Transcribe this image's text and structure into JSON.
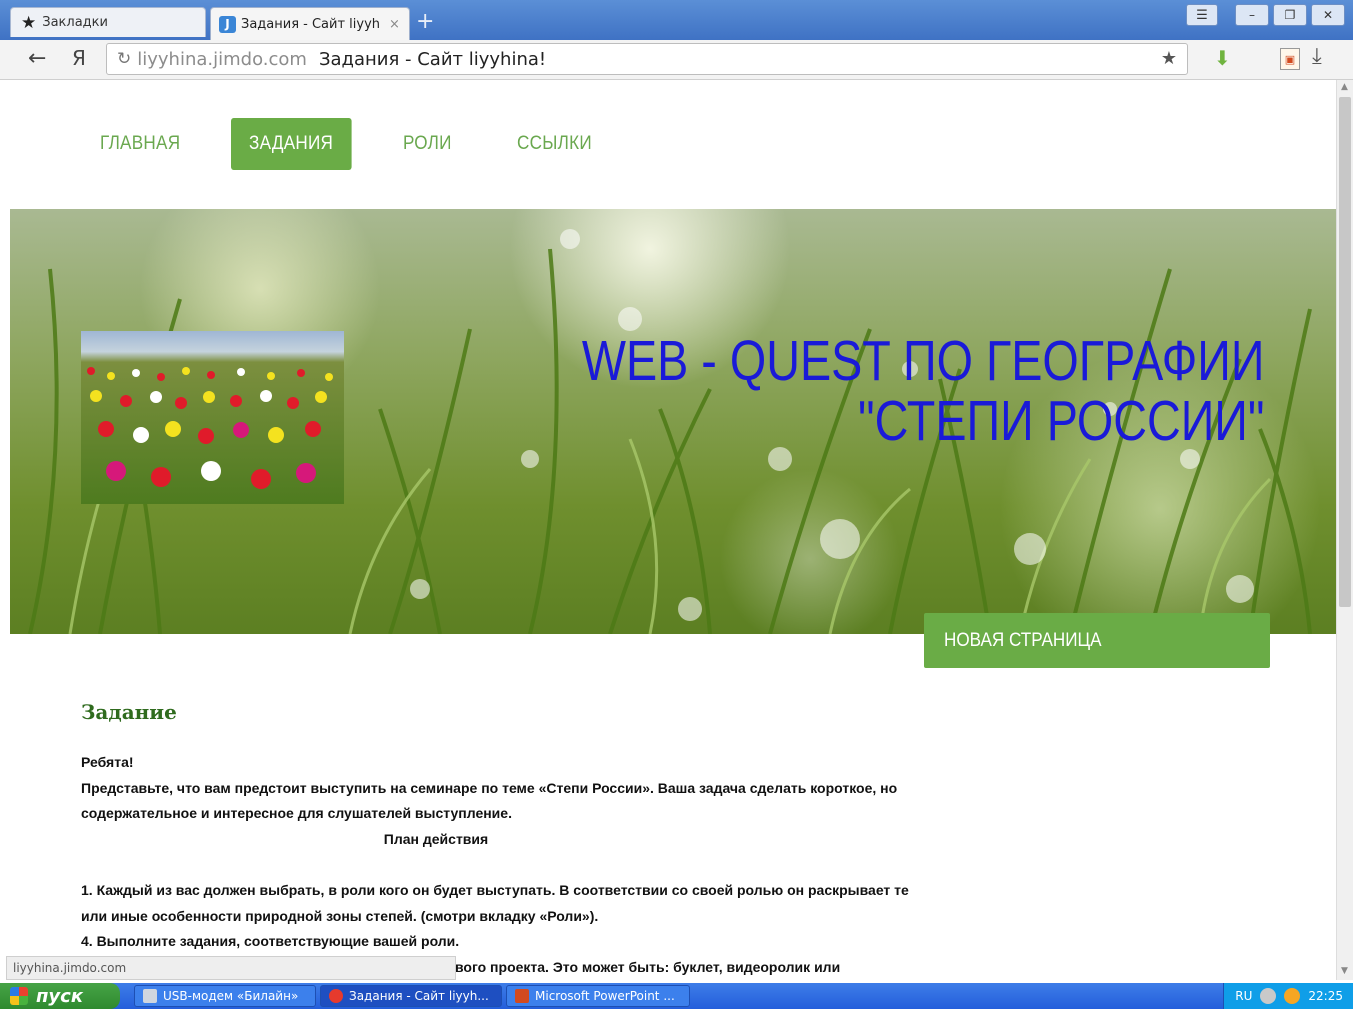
{
  "browser": {
    "bookmarks_tab": "Закладки",
    "active_tab_title": "Задания - Сайт liyyhina",
    "active_tab_favicon": "J",
    "close_glyph": "×",
    "new_tab_glyph": "+",
    "back_glyph": "←",
    "yandex_glyph": "Я",
    "reload_glyph": "↻",
    "address_host": "liyyhina.jimdo.com",
    "address_title": "Задания - Сайт liyyhina!",
    "bookmark_glyph": "★",
    "download_glyph": "⤓",
    "menu_glyph": "☰",
    "minimize_glyph": "–",
    "restore_glyph": "❐",
    "close_window_glyph": "✕"
  },
  "site": {
    "nav": [
      {
        "label": "ГЛАВНАЯ"
      },
      {
        "label": "ЗАДАНИЯ"
      },
      {
        "label": "РОЛИ"
      },
      {
        "label": "ССЫЛКИ"
      }
    ],
    "hero_title_line1": "WEB - QUEST ПО ГЕОГРАФИИ",
    "hero_title_line2": "\"СТЕПИ РОССИИ\"",
    "new_page_button": "НОВАЯ СТРАНИЦА",
    "heading": "Задание",
    "paragraphs": [
      "Ребята!",
      "Представьте, что вам предстоит выступить на семинаре по теме «Степи России». Ваша задача сделать  короткое, но содержательное и интересное для слушателей выступление.",
      "План действия",
      "1. Каждый из вас должен выбрать, в роли кого он будет выступать. В соответствии со своей ролью он раскрывает те или иные особенности природной зоны степей. (смотри вкладку «Роли»).",
      "4. Выполните задания, соответствующие вашей роли.",
      "вого проекта. Это может быть: буклет, видеоролик или"
    ]
  },
  "status_bar": {
    "url": "liyyhina.jimdo.com"
  },
  "taskbar": {
    "start": "пуск",
    "tasks": [
      {
        "label": "USB-модем «Билайн»"
      },
      {
        "label": "Задания - Сайт liyyh..."
      },
      {
        "label": "Microsoft PowerPoint ..."
      }
    ],
    "lang": "RU",
    "clock": "22:25"
  },
  "colors": {
    "nav_green": "#6aac46",
    "hero_title": "#1a1ad8",
    "heading_green": "#2f6b1e"
  }
}
